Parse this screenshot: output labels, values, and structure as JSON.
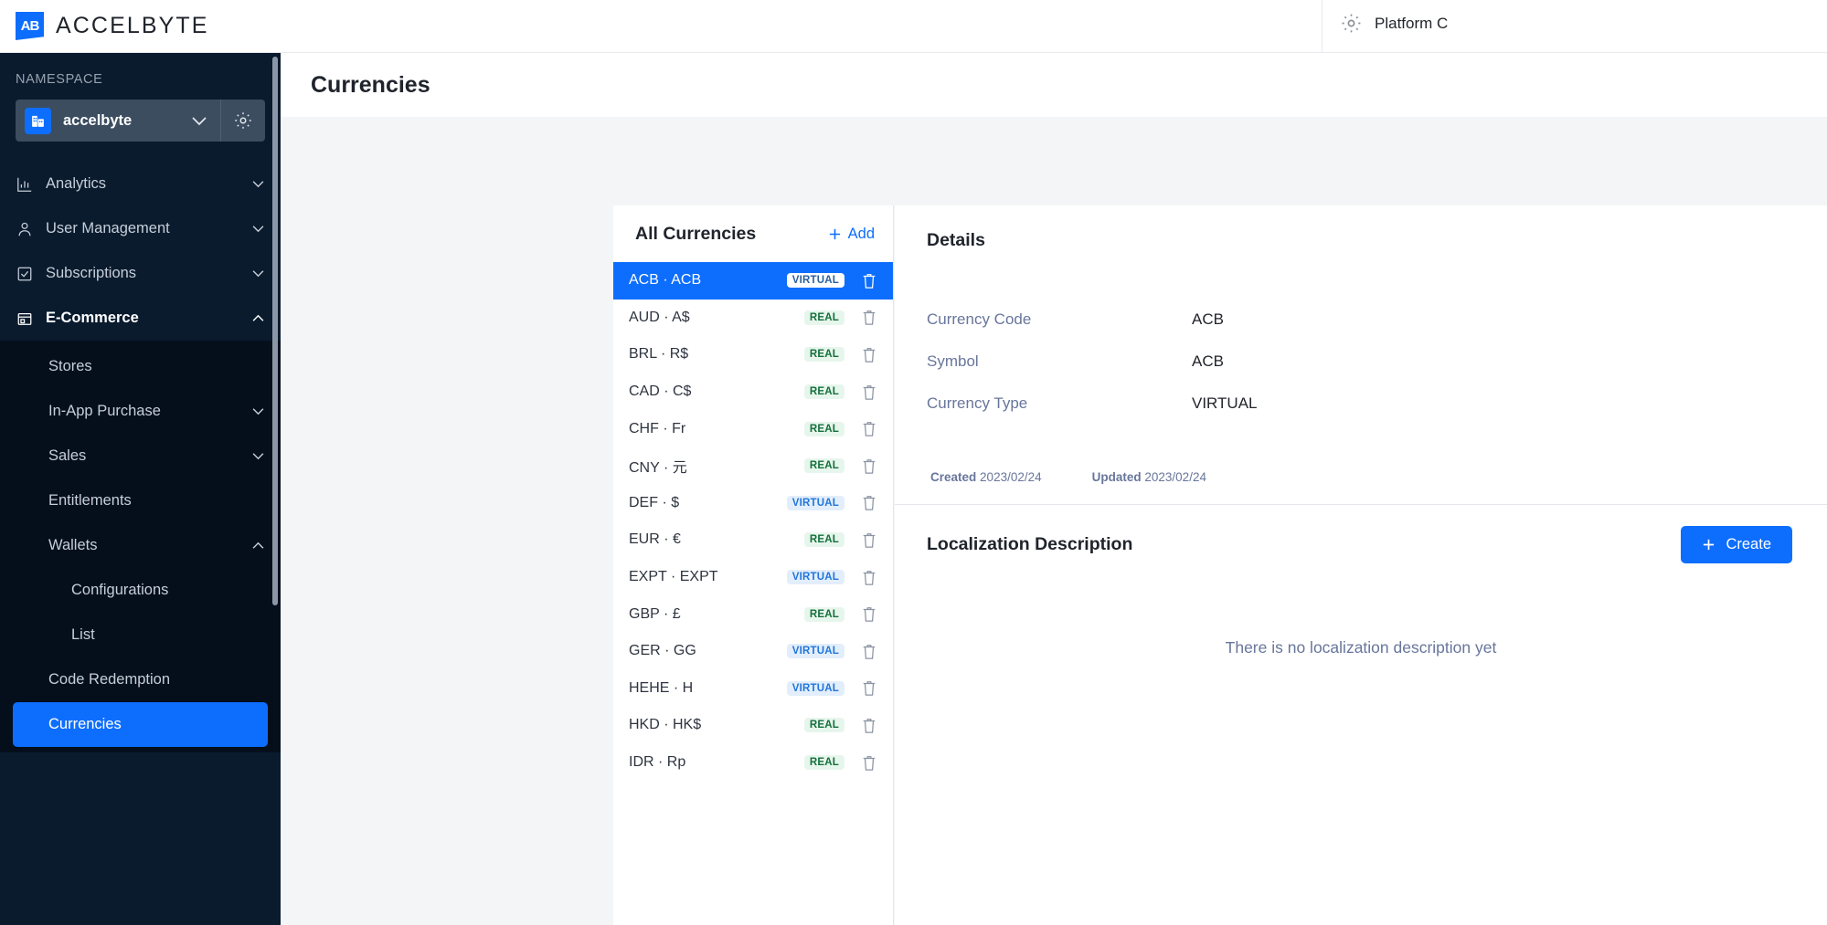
{
  "topbar": {
    "brand_mark": "AB",
    "brand_text": "ACCELBYTE",
    "gear_icon": "gear-icon",
    "platform_label": "Platform C"
  },
  "sidebar": {
    "namespace_label": "NAMESPACE",
    "namespace_value": "accelbyte",
    "namespace_chevron": "⌄",
    "namespace_gear_icon": "gear-icon",
    "nav": [
      {
        "label": "Analytics",
        "icon": "bar-chart-icon",
        "chevron": "⌄"
      },
      {
        "label": "User Management",
        "icon": "user-icon",
        "chevron": "⌄"
      },
      {
        "label": "Subscriptions",
        "icon": "checkbox-icon",
        "chevron": "⌄"
      },
      {
        "label": "E-Commerce",
        "icon": "store-icon",
        "chevron": "⌃"
      }
    ],
    "submenu": [
      {
        "label": "Stores",
        "chevron": ""
      },
      {
        "label": "In-App Purchase",
        "chevron": "⌄"
      },
      {
        "label": "Sales",
        "chevron": "⌄"
      },
      {
        "label": "Entitlements",
        "chevron": ""
      },
      {
        "label": "Wallets",
        "chevron": "⌃"
      },
      {
        "label": "Configurations",
        "chevron": "",
        "level": 2
      },
      {
        "label": "List",
        "chevron": "",
        "level": 2
      },
      {
        "label": "Code Redemption",
        "chevron": ""
      },
      {
        "label": "Currencies",
        "chevron": "",
        "active": true
      }
    ]
  },
  "page": {
    "title": "Currencies"
  },
  "list": {
    "title": "All Currencies",
    "add_label": "Add",
    "add_icon": "plus-icon",
    "delete_icon": "trash-icon",
    "rows": [
      {
        "name": "ACB · ACB",
        "type": "VIRTUAL",
        "selected": true
      },
      {
        "name": "AUD · A$",
        "type": "REAL"
      },
      {
        "name": "BRL · R$",
        "type": "REAL"
      },
      {
        "name": "CAD · C$",
        "type": "REAL"
      },
      {
        "name": "CHF · Fr",
        "type": "REAL"
      },
      {
        "name": "CNY · 元",
        "type": "REAL"
      },
      {
        "name": "DEF · $",
        "type": "VIRTUAL"
      },
      {
        "name": "EUR · €",
        "type": "REAL"
      },
      {
        "name": "EXPT · EXPT",
        "type": "VIRTUAL"
      },
      {
        "name": "GBP · £",
        "type": "REAL"
      },
      {
        "name": "GER · GG",
        "type": "VIRTUAL"
      },
      {
        "name": "HEHE · H",
        "type": "VIRTUAL"
      },
      {
        "name": "HKD · HK$",
        "type": "REAL"
      },
      {
        "name": "IDR · Rp",
        "type": "REAL"
      }
    ]
  },
  "details": {
    "title": "Details",
    "fields": [
      {
        "label": "Currency Code",
        "value": "ACB"
      },
      {
        "label": "Symbol",
        "value": "ACB"
      },
      {
        "label": "Currency Type",
        "value": "VIRTUAL"
      }
    ],
    "created_label": "Created",
    "created_value": "2023/02/24",
    "updated_label": "Updated",
    "updated_value": "2023/02/24"
  },
  "localization": {
    "title": "Localization Description",
    "create_label": "Create",
    "create_icon": "plus-icon",
    "empty_text": "There is no localization description yet"
  },
  "colors": {
    "accent": "#0d6efd",
    "sidebar_bg": "#0a1b2e",
    "submenu_bg": "#050f1c",
    "real_badge_bg": "#e7f6ec",
    "real_badge_fg": "#14703c",
    "virtual_badge_bg": "#e3eefc",
    "virtual_badge_fg": "#2176d9"
  }
}
